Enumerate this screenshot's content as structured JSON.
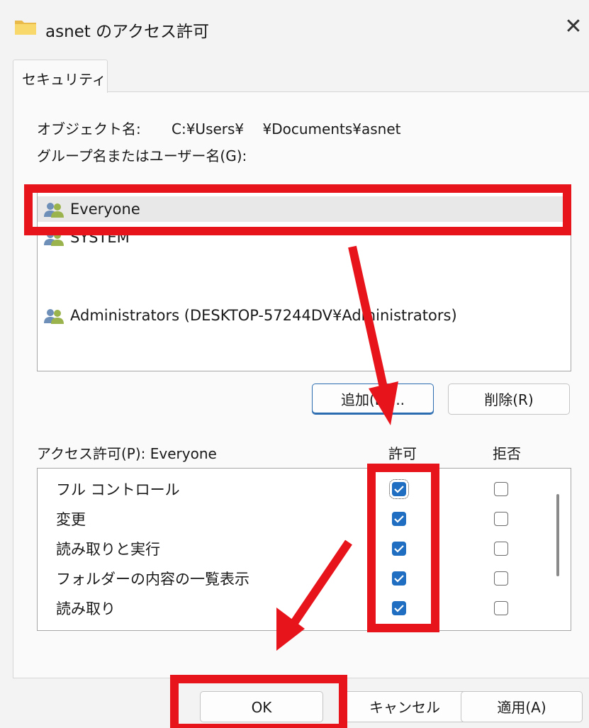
{
  "window": {
    "title": "asnet のアクセス許可",
    "close_glyph": "✕",
    "icon": "folder-icon"
  },
  "tabs": [
    {
      "label": "セキュリティ",
      "active": true
    }
  ],
  "object": {
    "label": "オブジェクト名:",
    "path": "C:¥Users¥　 ¥Documents¥asnet"
  },
  "groups": {
    "label": "グループ名またはユーザー名(G):",
    "items": [
      {
        "name": "Everyone",
        "selected": true,
        "icon": "users-icon"
      },
      {
        "name": "SYSTEM",
        "selected": false,
        "icon": "users-icon"
      },
      {
        "name": "Administrators (DESKTOP-57244DV¥Administrators)",
        "selected": false,
        "icon": "users-icon"
      }
    ],
    "add_label": "追加(D)...",
    "remove_label": "削除(R)"
  },
  "permissions": {
    "label": "アクセス許可(P): Everyone",
    "allow_header": "許可",
    "deny_header": "拒否",
    "rows": [
      {
        "name": "フル コントロール",
        "allow": true,
        "deny": false
      },
      {
        "name": "変更",
        "allow": true,
        "deny": false
      },
      {
        "name": "読み取りと実行",
        "allow": true,
        "deny": false
      },
      {
        "name": "フォルダーの内容の一覧表示",
        "allow": true,
        "deny": false
      },
      {
        "name": "読み取り",
        "allow": true,
        "deny": false
      }
    ]
  },
  "footer": {
    "ok_label": "OK",
    "cancel_label": "キャンセル",
    "apply_label": "適用(A)"
  },
  "colors": {
    "accent": "#1f6ec1",
    "annotation": "#e8141b",
    "selection": "#e8e8e8"
  }
}
